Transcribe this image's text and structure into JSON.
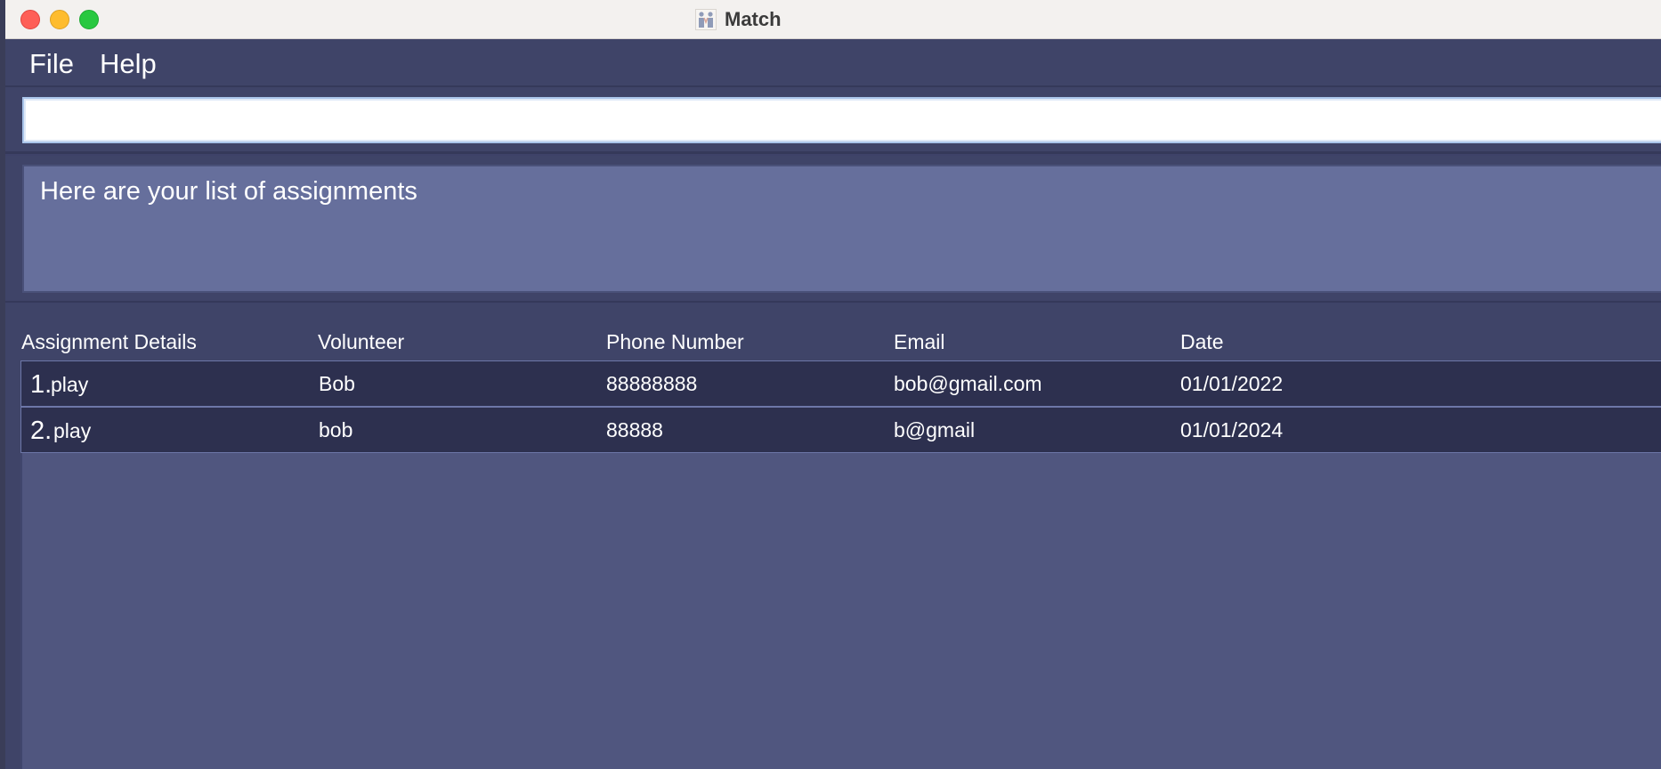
{
  "window": {
    "title": "Match",
    "app_icon": "match-app-icon"
  },
  "menu": {
    "file": "File",
    "help": "Help"
  },
  "command": {
    "value": "",
    "placeholder": ""
  },
  "result": {
    "message": "Here are your list of assignments"
  },
  "table": {
    "headers": [
      "Assignment Details",
      "Volunteer",
      "Phone Number",
      "Email",
      "Date"
    ],
    "rows": [
      {
        "index": "1.",
        "details": "play",
        "volunteer": "Bob",
        "phone": "88888888",
        "email": "bob@gmail.com",
        "date": "01/01/2022"
      },
      {
        "index": "2.",
        "details": "play",
        "volunteer": "bob",
        "phone": "88888",
        "email": "b@gmail",
        "date": "01/01/2024"
      }
    ]
  },
  "colors": {
    "title_bar": "#f3f1ef",
    "menu_bar": "#3f4468",
    "result_box": "#666f9c",
    "list_panel": "#50567f",
    "row": "#2d304f",
    "close": "#fe5f57",
    "minimize": "#febc2e",
    "maximize": "#28c840"
  }
}
